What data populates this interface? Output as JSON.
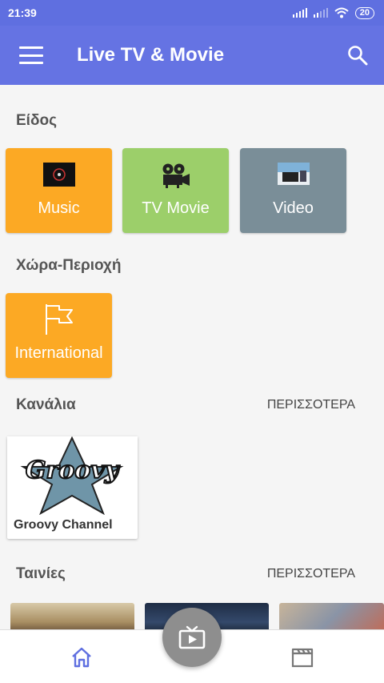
{
  "status_bar": {
    "time": "21:39",
    "battery": "20"
  },
  "app_bar": {
    "title": "Live TV & Movie"
  },
  "sections": {
    "genre": {
      "title": "Είδος"
    },
    "region": {
      "title": "Χώρα-Περιοχή"
    },
    "channels": {
      "title": "Κανάλια",
      "more": "ΠΕΡΙΣΣΟΤΕΡΑ"
    },
    "movies": {
      "title": "Ταινίες",
      "more": "ΠΕΡΙΣΣΟΤΕΡΑ"
    }
  },
  "genre_tiles": [
    {
      "label": "Music",
      "color": "#fca924",
      "icon": "music-thumb-icon"
    },
    {
      "label": "TV Movie",
      "color": "#9ccf6a",
      "icon": "film-projector-icon"
    },
    {
      "label": "Video",
      "color": "#7a8e98",
      "icon": "video-thumb-icon"
    }
  ],
  "region_tiles": [
    {
      "label": "International",
      "color": "#fca924",
      "icon": "flag-icon"
    }
  ],
  "channels": [
    {
      "name": "Groovy Channel",
      "logo_text": "Groovy"
    }
  ],
  "colors": {
    "primary": "#6573e3",
    "status_bar": "#5f6fe0",
    "fab": "#8e8e8e",
    "nav_icon": "#5f6fe0"
  },
  "bottom_nav": {
    "home_icon": "home-icon",
    "center_icon": "tv-play-icon",
    "movies_icon": "clapperboard-icon"
  }
}
